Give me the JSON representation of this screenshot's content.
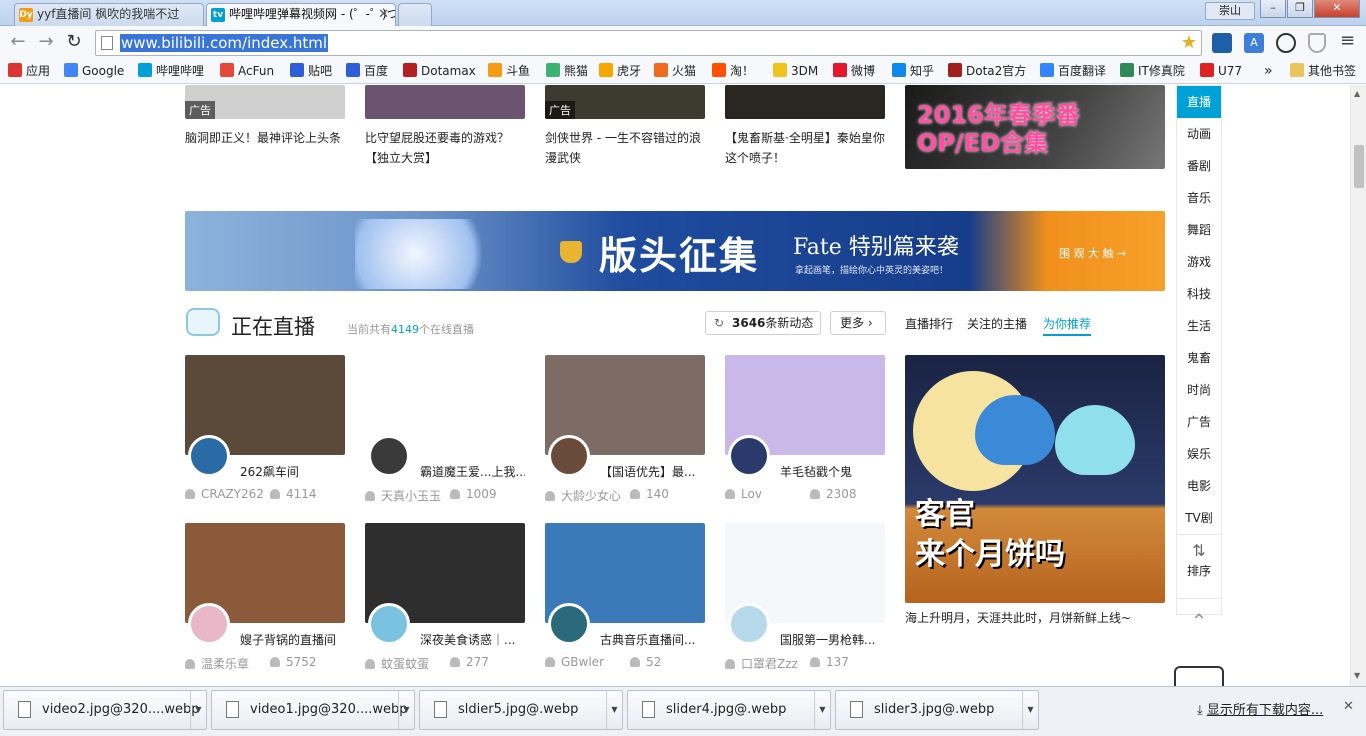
{
  "browser": {
    "tabs": [
      {
        "label": "yyf直播间 枫吹的我喘不过",
        "favicon": "Dy"
      },
      {
        "label": "哔哩哔哩弹幕视频网 - (゜-゜)つロ",
        "favicon": "tv"
      }
    ],
    "window_user": "崇山",
    "window_buttons": {
      "minimize": "–",
      "maximize": "❐",
      "close": "✕"
    },
    "url": "www.bilibili.com/index.html",
    "nav": {
      "back": "←",
      "forward": "→",
      "reload": "↻"
    },
    "star_icon": "star-icon",
    "menu_icon": "≡"
  },
  "bookmarks": {
    "items": [
      {
        "label": "应用",
        "icon": "apps-icon",
        "color": "#d33"
      },
      {
        "label": "Google",
        "icon": "google-icon",
        "color": "#4285f4"
      },
      {
        "label": "哔哩哔哩",
        "icon": "bilibili-icon",
        "color": "#00a1d6"
      },
      {
        "label": "AcFun",
        "icon": "acfun-icon",
        "color": "#e4483a"
      },
      {
        "label": "贴吧",
        "icon": "paw-icon",
        "color": "#2d5dd8"
      },
      {
        "label": "百度",
        "icon": "paw-icon",
        "color": "#2d5dd8"
      },
      {
        "label": "Dotamax",
        "icon": "dotamax-icon",
        "color": "#b32020"
      },
      {
        "label": "斗鱼",
        "icon": "douyu-icon",
        "color": "#f59b14"
      },
      {
        "label": "熊猫",
        "icon": "panda-icon",
        "color": "#3cb371"
      },
      {
        "label": "虎牙",
        "icon": "huya-icon",
        "color": "#f7a800"
      },
      {
        "label": "火猫",
        "icon": "huomao-icon",
        "color": "#ef6b1f"
      },
      {
        "label": "淘！",
        "icon": "taobao-icon",
        "color": "#ff5000"
      },
      {
        "label": "3DM",
        "icon": "3dm-icon",
        "color": "#f0c419"
      },
      {
        "label": "微博",
        "icon": "weibo-icon",
        "color": "#e6162d"
      },
      {
        "label": "知乎",
        "icon": "zhihu-icon",
        "color": "#0f88eb"
      },
      {
        "label": "Dota2官方",
        "icon": "dota2-icon",
        "color": "#a0211b"
      },
      {
        "label": "百度翻译",
        "icon": "translate-icon",
        "color": "#3385ff"
      },
      {
        "label": "IT修真院",
        "icon": "it-icon",
        "color": "#2e8b57"
      },
      {
        "label": "U77",
        "icon": "u77-icon",
        "color": "#d22"
      }
    ],
    "more": "»",
    "other": "其他书签"
  },
  "top_row": [
    {
      "caption": "脑洞即正义！最神评论上头条",
      "ad": "广告",
      "thumb_color": "#cfcfcf"
    },
    {
      "caption": "比守望屁股还要毒的游戏？【独立大赏】",
      "ad": "",
      "thumb_color": "#6a5470"
    },
    {
      "caption": "剑侠世界 - 一生不容错过的浪漫武侠",
      "ad": "广告",
      "thumb_color": "#3d3a30"
    },
    {
      "caption": "【鬼畜斯基·全明星】秦始皇你这个喷子！",
      "ad": "",
      "thumb_color": "#2a2622"
    }
  ],
  "promo_top": {
    "text": "2016年春季番 OP/ED合集"
  },
  "banner": {
    "title": "版头征集",
    "fate": "Fate 特别篇来袭",
    "sub": "拿起画笔，描绘你心中英灵的美姿吧！",
    "cta": "围 观 大 触 →"
  },
  "live": {
    "title": "正在直播",
    "online_prefix": "当前共有",
    "online_count": "4149",
    "online_suffix": "个在线直播",
    "updates_count": "3646",
    "updates_label": "条新动态",
    "more": "更多",
    "tabs": [
      "直播排行",
      "关注的主播",
      "为你推荐"
    ],
    "active_tab": 2,
    "items": [
      {
        "title": "262飙车间",
        "user": "CRAZY262",
        "viewers": "4114",
        "thumb": "#5b4a3a",
        "avatar": "#2a6aa5"
      },
      {
        "title": "霸道魔王爱...上我...",
        "user": "天真小玉玉",
        "viewers": "1009",
        "thumb": "#ffffff",
        "avatar": "#3a3a3a"
      },
      {
        "title": "【国语优先】最...",
        "user": "大龄少女心",
        "viewers": "140",
        "thumb": "#7d6b66",
        "avatar": "#6a4a3a"
      },
      {
        "title": "羊毛毡戳个鬼",
        "user": "Lov",
        "viewers": "2308",
        "thumb": "#c9b8e8",
        "avatar": "#2a3a6a"
      },
      {
        "title": "嫂子背锅的直播间",
        "user": "温柔乐章",
        "viewers": "5752",
        "thumb": "#8a5a3a",
        "avatar": "#e8b8c8"
      },
      {
        "title": "深夜美食诱惑｜...",
        "user": "蚊蛋蚊蛋",
        "viewers": "277",
        "thumb": "#2e2e2e",
        "avatar": "#7ac3e0"
      },
      {
        "title": "古典音乐直播间...",
        "user": "GBwler",
        "viewers": "52",
        "thumb": "#3a7ab8",
        "avatar": "#2a6a7a"
      },
      {
        "title": "国服第一男枪韩...",
        "user": "口罩君Zzz",
        "viewers": "137",
        "thumb": "#f4f8fb",
        "avatar": "#b8d8ec"
      }
    ]
  },
  "promo_side": {
    "text1": "客官",
    "text2": "来个月饼吗",
    "caption": "海上升明月，天涯共此时，月饼新鲜上线~"
  },
  "sidenav": {
    "items": [
      "直播",
      "动画",
      "番剧",
      "音乐",
      "舞蹈",
      "游戏",
      "科技",
      "生活",
      "鬼畜",
      "时尚",
      "广告",
      "娱乐",
      "电影",
      "TV剧"
    ],
    "active": 0,
    "sort_label": "排序",
    "up_icon": "chevron-up-icon"
  },
  "downloads": {
    "items": [
      "video2.jpg@320....webp",
      "video1.jpg@320....webp",
      "sldier5.jpg@.webp",
      "slider4.jpg@.webp",
      "slider3.jpg@.webp"
    ],
    "show_all": "显示所有下载内容...",
    "close": "✕"
  }
}
